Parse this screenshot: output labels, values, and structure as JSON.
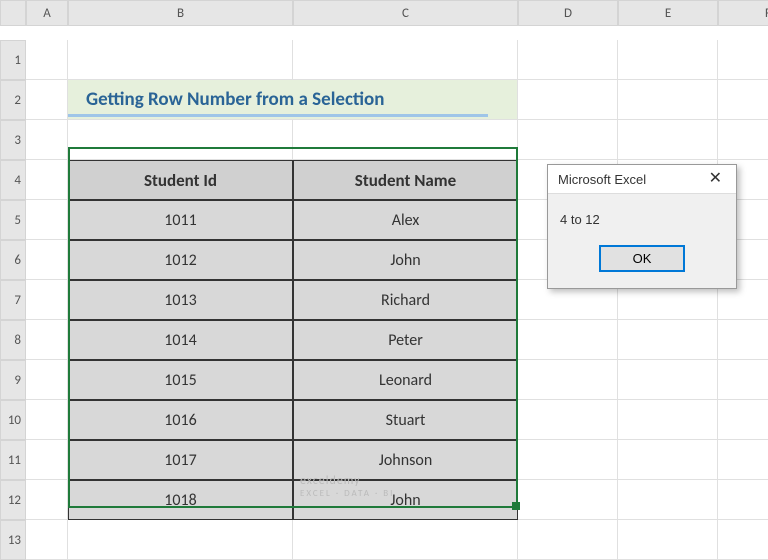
{
  "columns": [
    "",
    "A",
    "B",
    "C",
    "D",
    "E",
    "F"
  ],
  "rows": [
    "1",
    "2",
    "3",
    "4",
    "5",
    "6",
    "7",
    "8",
    "9",
    "10",
    "11",
    "12",
    "13"
  ],
  "title": "Getting Row Number from a Selection",
  "table": {
    "headers": [
      "Student Id",
      "Student Name"
    ],
    "rows": [
      [
        "1011",
        "Alex"
      ],
      [
        "1012",
        "John"
      ],
      [
        "1013",
        "Richard"
      ],
      [
        "1014",
        "Peter"
      ],
      [
        "1015",
        "Leonard"
      ],
      [
        "1016",
        "Stuart"
      ],
      [
        "1017",
        "Johnson"
      ],
      [
        "1018",
        "John"
      ]
    ]
  },
  "msgbox": {
    "title": "Microsoft Excel",
    "body": "4 to 12",
    "ok": "OK"
  },
  "watermark": {
    "main": "exceldemy",
    "sub": "EXCEL · DATA · BI"
  }
}
